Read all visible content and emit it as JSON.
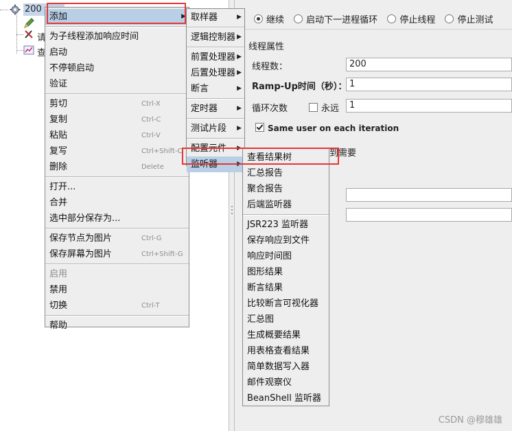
{
  "tree": {
    "thread_group_label": "200",
    "child_1_label": "请",
    "child_2_label": "查"
  },
  "config": {
    "action_options": [
      {
        "label": "继续",
        "selected": true
      },
      {
        "label": "启动下一进程循环",
        "selected": false
      },
      {
        "label": "停止线程",
        "selected": false
      },
      {
        "label": "停止测试",
        "selected": false
      }
    ],
    "section_title": "线程属性",
    "threads_label": "线程数：",
    "threads_value": "200",
    "rampup_label": "Ramp-Up时间（秒）：",
    "rampup_value": "1",
    "loops_label": "循环次数",
    "forever_label": "永远",
    "forever_checked": false,
    "loops_value": "1",
    "same_user_label": "Same user on each iteration",
    "same_user_checked": true,
    "partial_text": "到需要"
  },
  "context_menu": {
    "items": [
      {
        "label": "添加",
        "submenu": true,
        "active": true
      },
      {
        "separator": true
      },
      {
        "label": "为子线程添加响应时间"
      },
      {
        "label": "启动"
      },
      {
        "label": "不停顿启动"
      },
      {
        "label": "验证"
      },
      {
        "separator": true
      },
      {
        "label": "剪切",
        "shortcut": "Ctrl-X"
      },
      {
        "label": "复制",
        "shortcut": "Ctrl-C"
      },
      {
        "label": "粘贴",
        "shortcut": "Ctrl-V"
      },
      {
        "label": "复写",
        "shortcut": "Ctrl+Shift-C"
      },
      {
        "label": "删除",
        "shortcut": "Delete"
      },
      {
        "separator": true
      },
      {
        "label": "打开..."
      },
      {
        "label": "合并"
      },
      {
        "label": "选中部分保存为..."
      },
      {
        "separator": true
      },
      {
        "label": "保存节点为图片",
        "shortcut": "Ctrl-G"
      },
      {
        "label": "保存屏幕为图片",
        "shortcut": "Ctrl+Shift-G"
      },
      {
        "separator": true
      },
      {
        "label": "启用",
        "disabled": true
      },
      {
        "label": "禁用"
      },
      {
        "label": "切换",
        "shortcut": "Ctrl-T"
      },
      {
        "separator": true
      },
      {
        "label": "帮助"
      }
    ]
  },
  "add_menu": {
    "items": [
      {
        "label": "取样器",
        "submenu": true
      },
      {
        "separator": true
      },
      {
        "label": "逻辑控制器",
        "submenu": true
      },
      {
        "separator": true
      },
      {
        "label": "前置处理器",
        "submenu": true
      },
      {
        "label": "后置处理器",
        "submenu": true
      },
      {
        "label": "断言",
        "submenu": true
      },
      {
        "separator": true
      },
      {
        "label": "定时器",
        "submenu": true
      },
      {
        "separator": true
      },
      {
        "label": "测试片段",
        "submenu": true
      },
      {
        "separator": true
      },
      {
        "label": "配置元件",
        "submenu": true
      },
      {
        "label": "监听器",
        "submenu": true,
        "active": true
      }
    ]
  },
  "listener_menu": {
    "items": [
      {
        "label": "查看结果树"
      },
      {
        "label": "汇总报告"
      },
      {
        "label": "聚合报告"
      },
      {
        "label": "后端监听器"
      },
      {
        "separator": true
      },
      {
        "label": "JSR223 监听器"
      },
      {
        "label": "保存响应到文件"
      },
      {
        "label": "响应时间图"
      },
      {
        "label": "图形结果"
      },
      {
        "label": "断言结果"
      },
      {
        "label": "比较断言可视化器"
      },
      {
        "label": "汇总图"
      },
      {
        "label": "生成概要结果"
      },
      {
        "label": "用表格查看结果"
      },
      {
        "label": "简单数据写入器"
      },
      {
        "label": "邮件观察仪"
      },
      {
        "label": "BeanShell 监听器"
      }
    ]
  },
  "watermark": "CSDN @穆雄雄",
  "colors": {
    "highlight_box": "#e53535",
    "menu_active": "#b8cfe5",
    "menu_bg": "#eeeeee"
  }
}
